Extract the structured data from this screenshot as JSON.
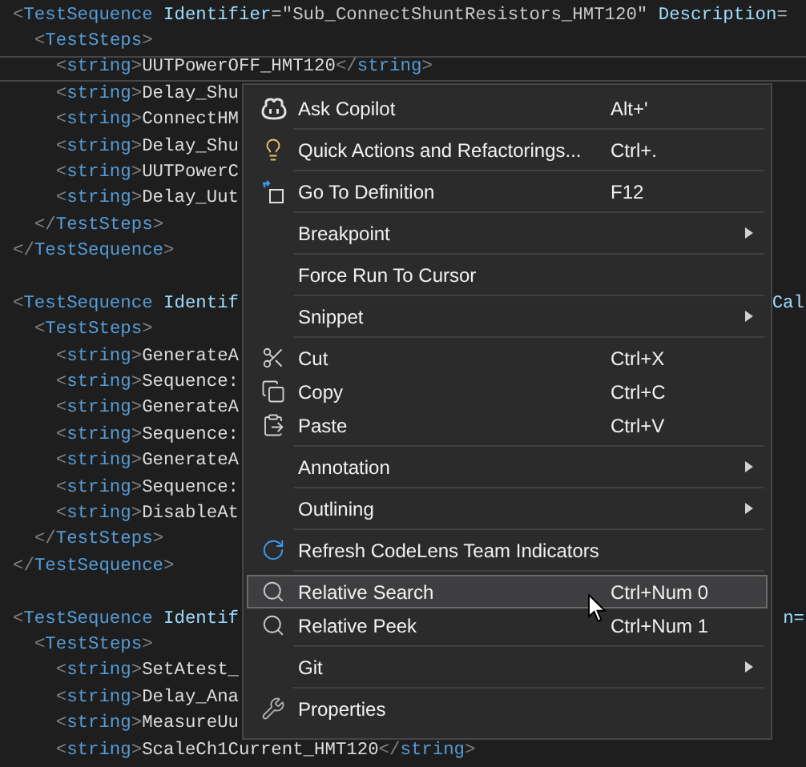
{
  "editor": {
    "lines": [
      {
        "text": "<TestSequence Identifier=\"Sub_ConnectShuntResistors_HMT120\" Description=",
        "current": false
      },
      {
        "text": "  <TestSteps>",
        "current": false
      },
      {
        "text": "    <string>UUTPowerOFF_HMT120</string>",
        "current": true
      },
      {
        "text": "    <string>Delay_Shu",
        "current": false
      },
      {
        "text": "    <string>ConnectHM",
        "current": false
      },
      {
        "text": "    <string>Delay_Shu",
        "current": false
      },
      {
        "text": "    <string>UUTPowerC",
        "current": false
      },
      {
        "text": "    <string>Delay_Uut",
        "current": false
      },
      {
        "text": "  </TestSteps>",
        "current": false
      },
      {
        "text": "</TestSequence>",
        "current": false
      },
      {
        "current": false
      },
      {
        "text": "<TestSequence Identif",
        "tail": "Cal",
        "current": false
      },
      {
        "text": "  <TestSteps>",
        "current": false
      },
      {
        "text": "    <string>GenerateA",
        "current": false
      },
      {
        "text": "    <string>Sequence:",
        "current": false
      },
      {
        "text": "    <string>GenerateA",
        "current": false
      },
      {
        "text": "    <string>Sequence:",
        "current": false
      },
      {
        "text": "    <string>GenerateA",
        "current": false
      },
      {
        "text": "    <string>Sequence:",
        "current": false
      },
      {
        "text": "    <string>DisableAt",
        "current": false
      },
      {
        "text": "  </TestSteps>",
        "current": false
      },
      {
        "text": "</TestSequence>",
        "current": false
      },
      {
        "current": false
      },
      {
        "text": "<TestSequence Identif",
        "tail": "n=",
        "current": false
      },
      {
        "text": "  <TestSteps>",
        "current": false
      },
      {
        "text": "    <string>SetAtest_",
        "current": false
      },
      {
        "text": "    <string>Delay_Ana",
        "current": false
      },
      {
        "text": "    <string>MeasureUu",
        "current": false
      },
      {
        "text": "    <string>ScaleCh1Current_HMT120</string>",
        "current": false
      }
    ]
  },
  "context_menu": {
    "groups": [
      {
        "items": [
          {
            "label": "Ask Copilot",
            "shortcut": "Alt+'",
            "kind": "copilot",
            "submenu": false,
            "selected": false
          }
        ]
      },
      {
        "items": [
          {
            "label": "Quick Actions and Refactorings...",
            "shortcut": "Ctrl+.",
            "kind": "bulb",
            "submenu": false,
            "selected": false
          }
        ]
      },
      {
        "items": [
          {
            "label": "Go To Definition",
            "shortcut": "F12",
            "kind": "goto",
            "submenu": false,
            "selected": false
          }
        ]
      },
      {
        "items": [
          {
            "label": "Breakpoint",
            "submenu": true,
            "selected": false
          }
        ]
      },
      {
        "items": [
          {
            "label": "Force Run To Cursor",
            "submenu": false,
            "selected": false
          }
        ]
      },
      {
        "items": [
          {
            "label": "Snippet",
            "submenu": true,
            "selected": false
          }
        ]
      },
      {
        "items": [
          {
            "label": "Cut",
            "shortcut": "Ctrl+X",
            "kind": "cut",
            "submenu": false,
            "selected": false
          },
          {
            "label": "Copy",
            "shortcut": "Ctrl+C",
            "kind": "copy",
            "submenu": false,
            "selected": false
          },
          {
            "label": "Paste",
            "shortcut": "Ctrl+V",
            "kind": "paste",
            "submenu": false,
            "selected": false
          }
        ]
      },
      {
        "items": [
          {
            "label": "Annotation",
            "submenu": true,
            "selected": false
          }
        ]
      },
      {
        "items": [
          {
            "label": "Outlining",
            "submenu": true,
            "selected": false
          }
        ]
      },
      {
        "items": [
          {
            "label": "Refresh CodeLens Team Indicators",
            "kind": "refresh",
            "submenu": false,
            "selected": false
          }
        ]
      },
      {
        "items": [
          {
            "label": "Relative Search",
            "shortcut": "Ctrl+Num 0",
            "kind": "search",
            "submenu": false,
            "selected": true
          },
          {
            "label": "Relative Peek",
            "shortcut": "Ctrl+Num 1",
            "kind": "search",
            "submenu": false,
            "selected": false
          }
        ]
      },
      {
        "items": [
          {
            "label": "Git",
            "submenu": true,
            "selected": false
          }
        ]
      },
      {
        "items": [
          {
            "label": "Properties",
            "kind": "wrench",
            "submenu": false,
            "selected": false
          }
        ]
      }
    ]
  }
}
